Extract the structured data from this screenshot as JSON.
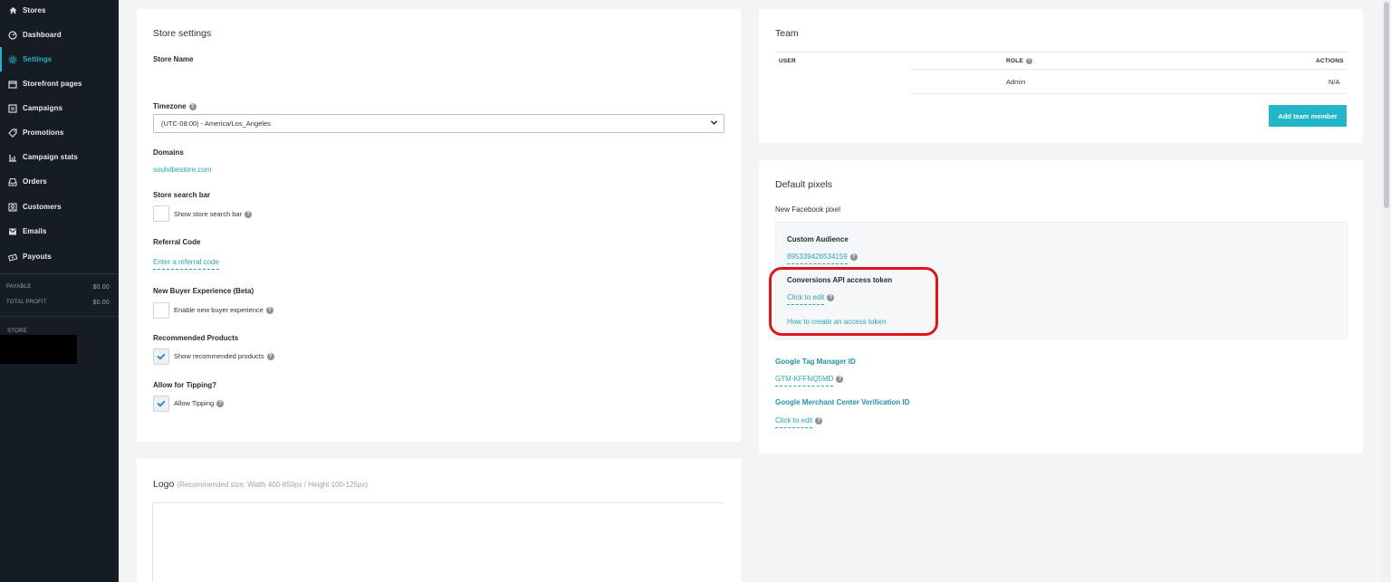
{
  "sidebar": {
    "items": [
      {
        "label": "Stores",
        "icon": "home-icon"
      },
      {
        "label": "Dashboard",
        "icon": "gauge-icon"
      },
      {
        "label": "Settings",
        "icon": "gear-icon"
      },
      {
        "label": "Storefront pages",
        "icon": "storefront-icon"
      },
      {
        "label": "Campaigns",
        "icon": "list-icon"
      },
      {
        "label": "Promotions",
        "icon": "tag-icon"
      },
      {
        "label": "Campaign stats",
        "icon": "bar-chart-icon"
      },
      {
        "label": "Orders",
        "icon": "inbox-icon"
      },
      {
        "label": "Customers",
        "icon": "users-icon"
      },
      {
        "label": "Emails",
        "icon": "envelope-icon"
      },
      {
        "label": "Payouts",
        "icon": "money-icon"
      }
    ],
    "payable_label": "PAYABLE",
    "payable_value": "$0.00",
    "profit_label": "TOTAL PROFIT",
    "profit_value": "$0.00",
    "store_label": "STORE",
    "active_color": "#21b3c6"
  },
  "store_settings": {
    "title": "Store settings",
    "store_name_label": "Store Name",
    "timezone_label": "Timezone",
    "timezone_value": "(UTC-08:00) - America/Los_Angeles",
    "domains_label": "Domains",
    "domain_value": "soulvibestore.com",
    "search_bar_label": "Store search bar",
    "search_bar_checkbox": "Show store search bar",
    "referral_label": "Referral Code",
    "referral_link": "Enter a referral code",
    "buyer_exp_label": "New Buyer Experience (Beta)",
    "buyer_exp_checkbox": "Enable new buyer experience",
    "recommended_label": "Recommended Products",
    "recommended_checkbox": "Show recommended products",
    "tipping_label": "Allow for Tipping?",
    "tipping_checkbox": "Allow Tipping"
  },
  "logo": {
    "title": "Logo",
    "hint": "(Recommended size: Width 400-850px / Height 100-125px)"
  },
  "team": {
    "title": "Team",
    "col_user": "USER",
    "col_role": "ROLE",
    "col_actions": "ACTIONS",
    "row_role": "Admin",
    "row_actions": "N/A",
    "add_button": "Add team member",
    "button_color": "#21b6c8"
  },
  "pixels": {
    "title": "Default pixels",
    "new_fb_label": "New Facebook pixel",
    "custom_audience_label": "Custom Audience",
    "custom_audience_value": "895339426534159",
    "capi_label": "Conversions API access token",
    "capi_edit": "Click to edit",
    "capi_howto": "How to create an access token",
    "gtm_label": "Google Tag Manager ID",
    "gtm_value": "GTM-KFFNQ5MD",
    "gmc_label": "Google Merchant Center Verification ID",
    "gmc_edit": "Click to edit",
    "highlight_color": "#e0141c"
  }
}
